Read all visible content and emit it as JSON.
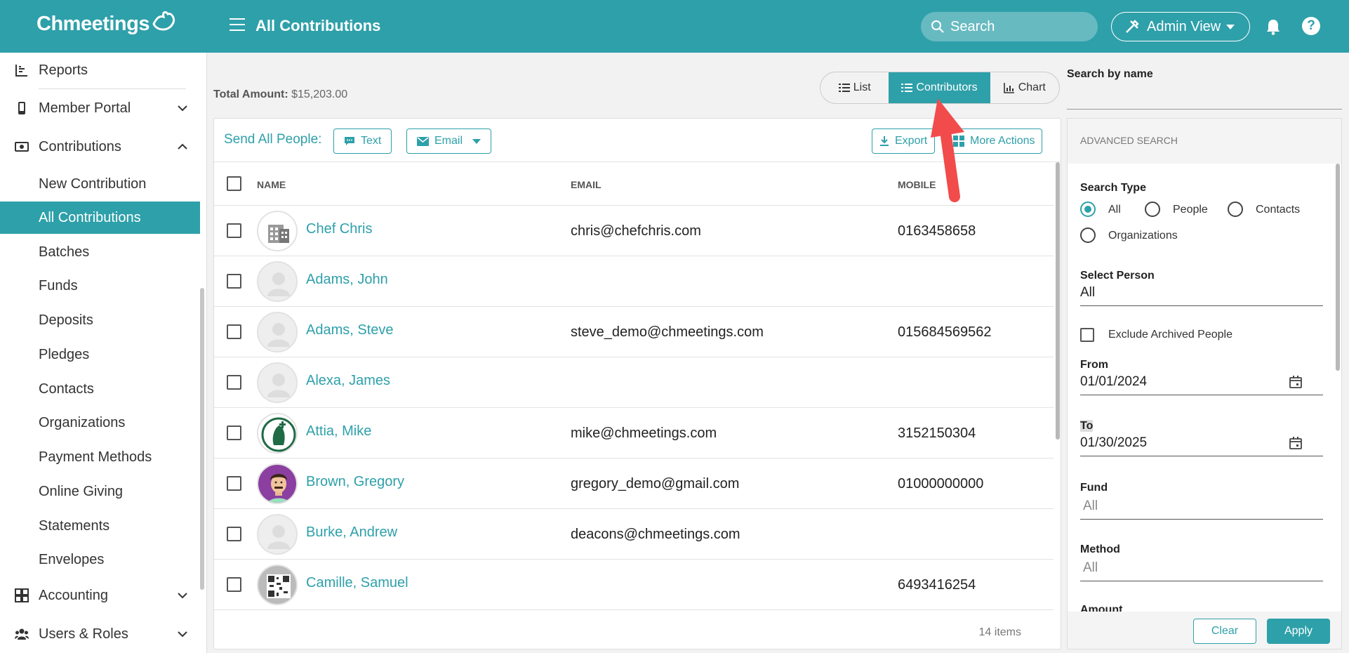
{
  "app": {
    "logo_text": "Chmeetings",
    "page_title": "All Contributions"
  },
  "header": {
    "search_placeholder": "Search",
    "admin_view_label": "Admin View"
  },
  "sidebar": {
    "reports": "Reports",
    "member_portal": "Member Portal",
    "contributions": "Contributions",
    "sub_items": [
      "New Contribution",
      "All Contributions",
      "Batches",
      "Funds",
      "Deposits",
      "Pledges",
      "Contacts",
      "Organizations",
      "Payment Methods",
      "Online Giving",
      "Statements",
      "Envelopes"
    ],
    "active_sub": "All Contributions",
    "accounting": "Accounting",
    "users_roles": "Users & Roles"
  },
  "summary": {
    "total_label": "Total Amount:",
    "total_value": "$15,203.00"
  },
  "view_toggle": {
    "list": "List",
    "contributors": "Contributors",
    "chart": "Chart",
    "active": "Contributors"
  },
  "toolbar": {
    "send_all_label": "Send All People:",
    "text_btn": "Text",
    "email_btn": "Email",
    "export_btn": "Export",
    "more_actions_btn": "More Actions"
  },
  "table": {
    "columns": [
      "NAME",
      "EMAIL",
      "MOBILE"
    ],
    "rows": [
      {
        "name": "Chef Chris",
        "email": "chris@chefchris.com",
        "mobile": "0163458658",
        "avatar": "building-icon"
      },
      {
        "name": "Adams, John",
        "email": "",
        "mobile": "",
        "avatar": "default-person-icon"
      },
      {
        "name": "Adams, Steve",
        "email": "steve_demo@chmeetings.com",
        "mobile": "015684569562",
        "avatar": "default-person-icon"
      },
      {
        "name": "Alexa, James",
        "email": "",
        "mobile": "",
        "avatar": "default-person-icon"
      },
      {
        "name": "Attia, Mike",
        "email": "mike@chmeetings.com",
        "mobile": "3152150304",
        "avatar": "church-logo-icon"
      },
      {
        "name": "Brown, Gregory",
        "email": "gregory_demo@gmail.com",
        "mobile": "01000000000",
        "avatar": "cartoon-man-icon"
      },
      {
        "name": "Burke, Andrew",
        "email": "deacons@chmeetings.com",
        "mobile": "",
        "avatar": "default-person-icon"
      },
      {
        "name": "Camille, Samuel",
        "email": "",
        "mobile": "6493416254",
        "avatar": "qr-code-icon"
      }
    ],
    "item_count": "14 items"
  },
  "search_by_name": {
    "label": "Search by name",
    "value": ""
  },
  "advanced_search": {
    "title": "ADVANCED SEARCH",
    "search_type_label": "Search Type",
    "search_type_options": [
      "All",
      "People",
      "Contacts",
      "Organizations"
    ],
    "search_type_selected": "All",
    "select_person_label": "Select Person",
    "select_person_value": "All",
    "exclude_archived_label": "Exclude Archived People",
    "exclude_archived_checked": false,
    "from_label": "From",
    "from_value": "01/01/2024",
    "to_label": "To",
    "to_value": "01/30/2025",
    "fund_label": "Fund",
    "fund_placeholder": "All",
    "method_label": "Method",
    "method_placeholder": "All",
    "amount_label": "Amount",
    "clear_btn": "Clear",
    "apply_btn": "Apply"
  },
  "colors": {
    "brand": "#2ea0aa",
    "annotation_arrow": "#f24b4b"
  }
}
